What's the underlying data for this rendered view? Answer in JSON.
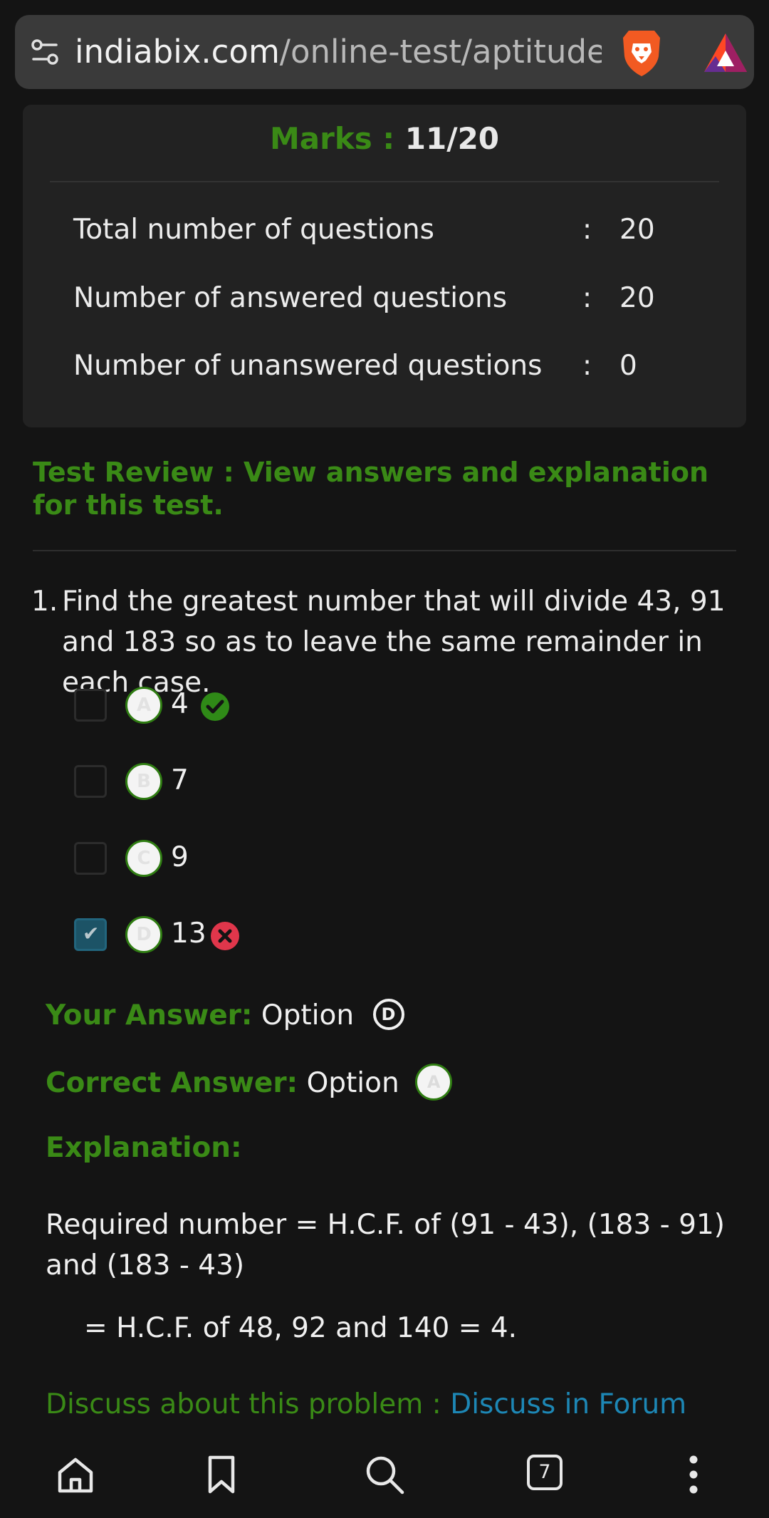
{
  "browser": {
    "url_domain": "indiabix.com",
    "url_path": "/online-test/aptitude-tes",
    "tab_count": "7"
  },
  "result": {
    "marks_label": "Marks :",
    "marks_value": "11/20",
    "stats": [
      {
        "label": "Total number of questions",
        "colon": ":",
        "value": "20"
      },
      {
        "label": "Number of answered questions",
        "colon": ":",
        "value": "20"
      },
      {
        "label": "Number of unanswered questions",
        "colon": ":",
        "value": "0"
      }
    ]
  },
  "review_heading": "Test Review : View answers and explanation for this test.",
  "question": {
    "number": "1.",
    "text": "Find the greatest number that will divide 43, 91 and 183 so as to leave the same remainder in each case.",
    "options": [
      {
        "letter": "A",
        "text": "4",
        "checked": false,
        "status": "correct"
      },
      {
        "letter": "B",
        "text": "7",
        "checked": false,
        "status": ""
      },
      {
        "letter": "C",
        "text": "9",
        "checked": false,
        "status": ""
      },
      {
        "letter": "D",
        "text": "13",
        "checked": true,
        "status": "wrong"
      }
    ],
    "your_answer_label": "Your Answer:",
    "your_answer_text": "Option",
    "your_answer_letter": "D",
    "correct_answer_label": "Correct Answer:",
    "correct_answer_text": "Option",
    "correct_answer_letter": "A",
    "explanation_label": "Explanation:",
    "explanation_line1": "Required number = H.C.F. of (91 - 43), (183 - 91) and (183 - 43)",
    "explanation_line2": "= H.C.F. of 48, 92 and 140 = 4.",
    "discuss_label": "Discuss about this problem :",
    "discuss_link": "Discuss in Forum"
  },
  "colors": {
    "accent_green": "#3a8a16",
    "link_blue": "#1d87b5",
    "wrong_red": "#e0364b",
    "checked_blue": "#1c5366"
  }
}
